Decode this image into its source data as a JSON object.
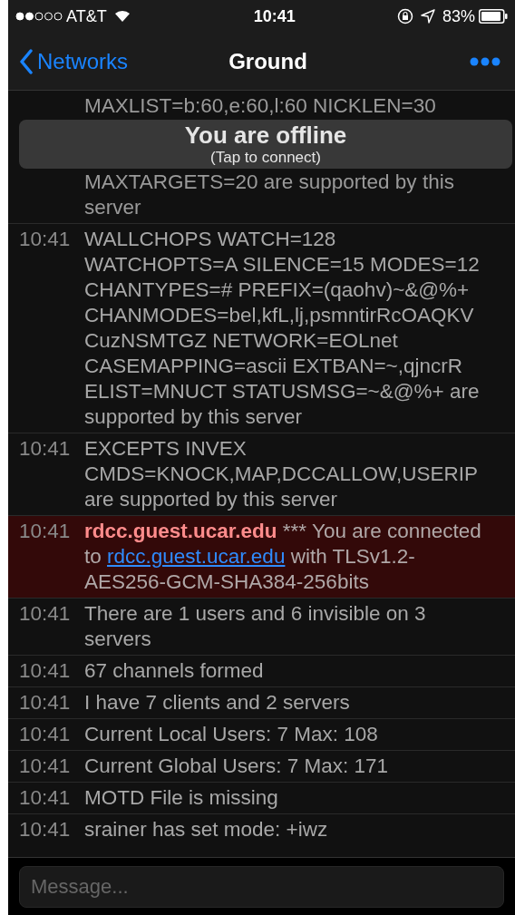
{
  "status_bar": {
    "carrier": "AT&T",
    "time": "10:41",
    "battery": "83%"
  },
  "nav": {
    "back": "Networks",
    "title": "Ground"
  },
  "toast": {
    "title": "You are offline",
    "subtitle": "(Tap to connect)"
  },
  "messages": [
    {
      "kind": "covered",
      "top": "MAXLIST=b:60,e:60,l:60 NICKLEN=30",
      "text": "MAXTARGETS=20 are supported by this server"
    },
    {
      "kind": "plain",
      "time": "10:41",
      "text": "WALLCHOPS WATCH=128 WATCHOPTS=A SILENCE=15 MODES=12 CHANTYPES=# PREFIX=(qaohv)~&@%+ CHANMODES=bel,kfL,lj,psmntirRcOAQKV CuzNSMTGZ NETWORK=EOLnet CASEMAPPING=ascii EXTBAN=~,qjncrR ELIST=MNUCT STATUSMSG=~&@%+ are supported by this server"
    },
    {
      "kind": "plain",
      "time": "10:41",
      "text": "EXCEPTS INVEX CMDS=KNOCK,MAP,DCCALLOW,USERIP are supported by this server"
    },
    {
      "kind": "highlight",
      "time": "10:41",
      "sender": "rdcc.guest.ucar.edu",
      "text": " *** You are connected to ",
      "link": "rdcc.guest.ucar.edu",
      "after": " with TLSv1.2-AES256-GCM-SHA384-256bits"
    },
    {
      "kind": "plain",
      "time": "10:41",
      "text": "There are 1 users and 6 invisible on 3 servers"
    },
    {
      "kind": "plain",
      "time": "10:41",
      "text": "67 channels formed"
    },
    {
      "kind": "plain",
      "time": "10:41",
      "text": "I have 7 clients and 2 servers"
    },
    {
      "kind": "plain",
      "time": "10:41",
      "text": "Current Local Users: 7  Max: 108"
    },
    {
      "kind": "plain",
      "time": "10:41",
      "text": "Current Global Users: 7  Max: 171"
    },
    {
      "kind": "plain",
      "time": "10:41",
      "text": "MOTD File is missing"
    },
    {
      "kind": "plain",
      "time": "10:41",
      "text": "srainer has set mode: +iwz"
    }
  ],
  "composer": {
    "placeholder": "Message..."
  }
}
